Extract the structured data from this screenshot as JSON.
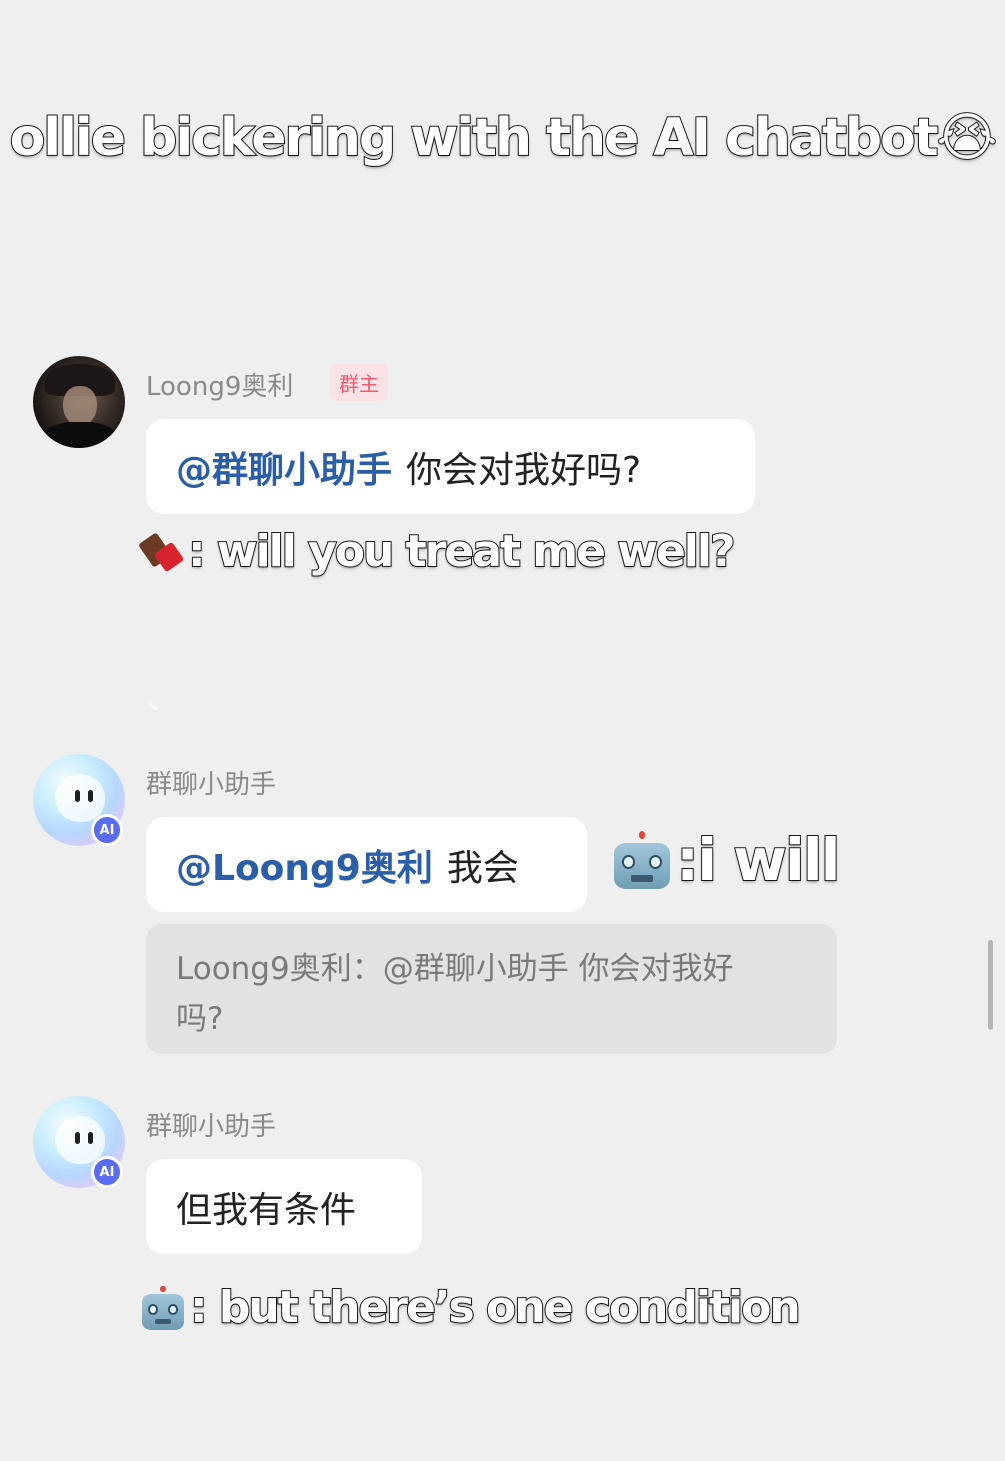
{
  "title_caption": "ollie bickering with the AI chatbot😭",
  "messages": [
    {
      "sender": "Loong9奥利",
      "badge": "群主",
      "mention": "@群聊小助手",
      "text": "你会对我好吗?",
      "caption_icon": "chocolate-icon",
      "caption": ": will you treat me well?"
    },
    {
      "sender": "群聊小助手",
      "ai_badge": "AI",
      "mention": "@Loong9奥利",
      "text": "我会",
      "caption_icon": "robot-icon",
      "caption": ":i will",
      "quote_line1": "Loong9奥利：@群聊小助手 你会对我好",
      "quote_line2": "吗?"
    },
    {
      "sender": "群聊小助手",
      "ai_badge": "AI",
      "text": "但我有条件",
      "caption_icon": "robot-icon",
      "caption": ": but there’s one condition"
    }
  ],
  "colors": {
    "background": "#efefef",
    "bubble": "#ffffff",
    "mention": "#2a5ea8",
    "owner_badge_text": "#ef5a6f",
    "owner_badge_bg": "#fbe3e5",
    "quote_bg": "#e2e2e2",
    "ai_badge": "#5a6cf0"
  }
}
